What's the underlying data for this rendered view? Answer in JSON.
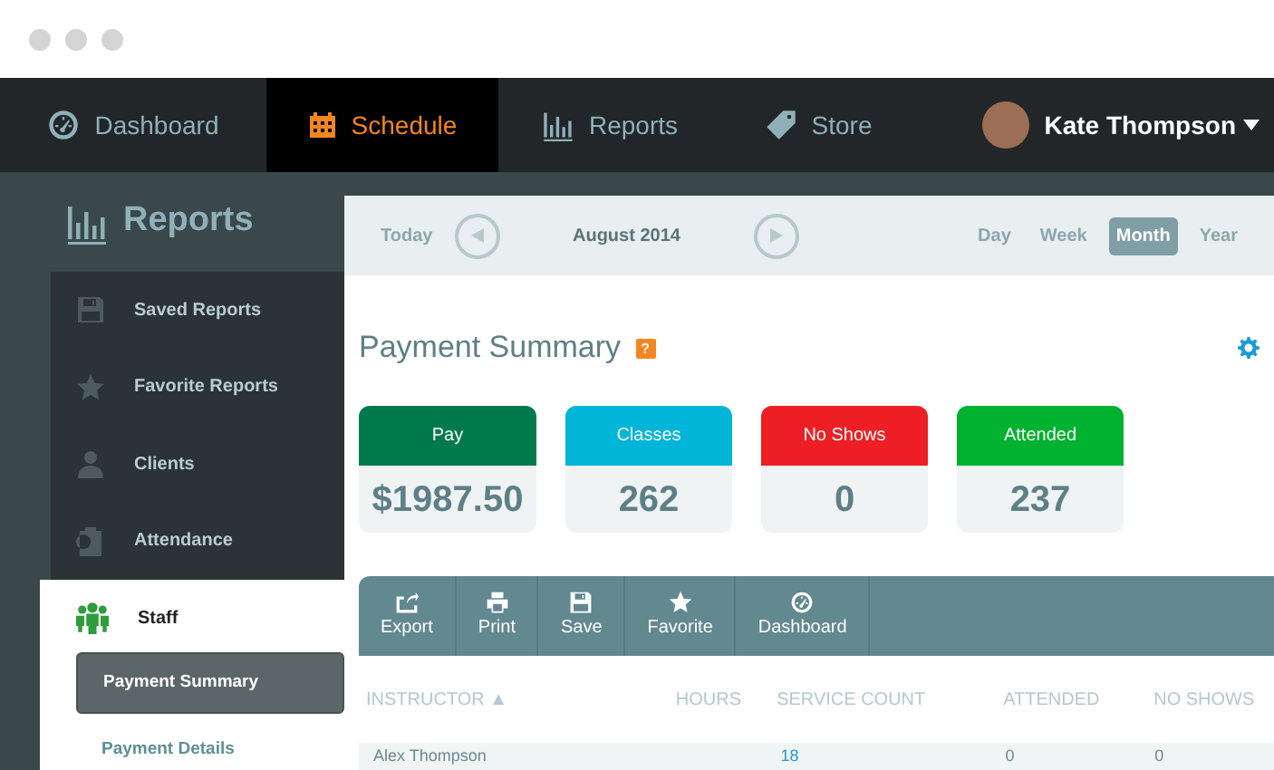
{
  "nav": {
    "items": [
      {
        "label": "Dashboard",
        "kind": "gauge",
        "selected": false
      },
      {
        "label": "Schedule",
        "kind": "calendar",
        "selected": true
      },
      {
        "label": "Reports",
        "kind": "chart",
        "selected": false
      },
      {
        "label": "Store",
        "kind": "tag",
        "selected": false
      }
    ],
    "user": {
      "name": "Kate Thompson"
    }
  },
  "sidebar": {
    "title": "Reports",
    "items": [
      {
        "label": "Saved Reports",
        "kind": "disk",
        "expanded": false
      },
      {
        "label": "Favorite Reports",
        "kind": "star",
        "expanded": false
      },
      {
        "label": "Clients",
        "kind": "person",
        "expanded": false
      },
      {
        "label": "Attendance",
        "kind": "clipboard",
        "expanded": false
      },
      {
        "label": "Staff",
        "kind": "group",
        "expanded": true,
        "children": [
          {
            "label": "Payment Summary",
            "selected": true
          },
          {
            "label": "Payment Details",
            "selected": false
          }
        ]
      }
    ]
  },
  "calendar": {
    "today": "Today",
    "period": "August 2014",
    "views": [
      {
        "label": "Day",
        "selected": false
      },
      {
        "label": "Week",
        "selected": false
      },
      {
        "label": "Month",
        "selected": true
      },
      {
        "label": "Year",
        "selected": false
      }
    ]
  },
  "report": {
    "title": "Payment Summary",
    "help": "?",
    "metrics": [
      {
        "label": "Pay",
        "value": "$1987.50",
        "color": "#007a4d"
      },
      {
        "label": "Classes",
        "value": "262",
        "color": "#00b5d8"
      },
      {
        "label": "No Shows",
        "value": "0",
        "color": "#ee1f24"
      },
      {
        "label": "Attended",
        "value": "237",
        "color": "#00b22f"
      }
    ],
    "toolbar": [
      {
        "label": "Export",
        "kind": "export"
      },
      {
        "label": "Print",
        "kind": "print"
      },
      {
        "label": "Save",
        "kind": "disk"
      },
      {
        "label": "Favorite",
        "kind": "star"
      },
      {
        "label": "Dashboard",
        "kind": "gauge"
      }
    ],
    "table": {
      "columns": [
        "INSTRUCTOR ▲",
        "HOURS",
        "SERVICE COUNT",
        "ATTENDED",
        "NO SHOWS"
      ],
      "rows": [
        [
          "Alex Thompson",
          "",
          "18",
          "0",
          "0"
        ]
      ]
    }
  }
}
